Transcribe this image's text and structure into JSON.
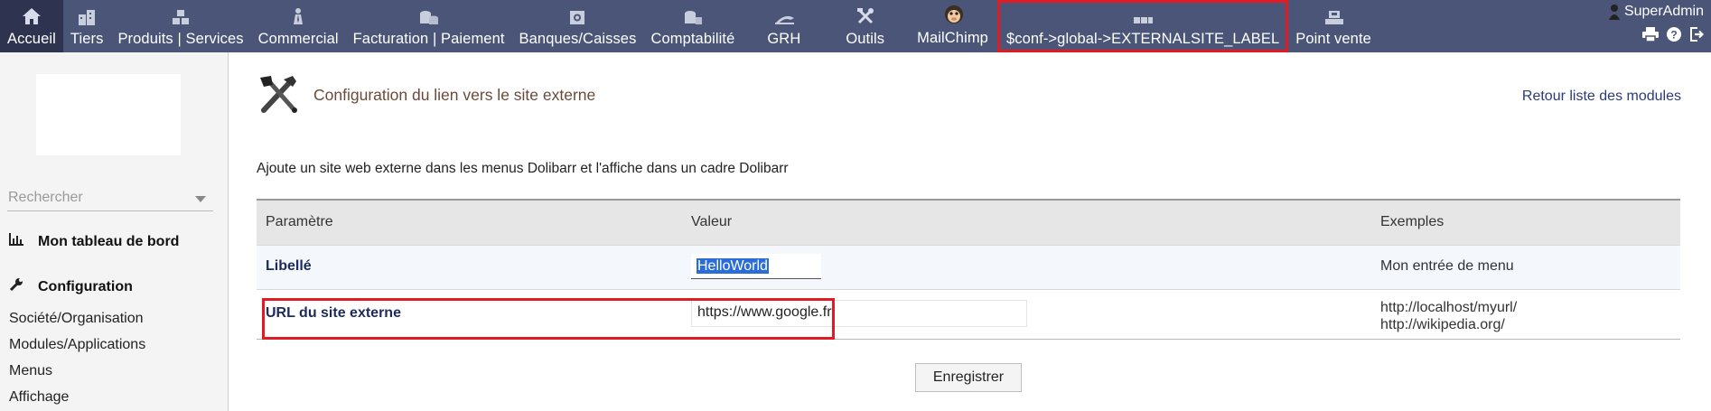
{
  "topmenu": {
    "items": [
      {
        "label": "Accueil",
        "icon": "home-icon",
        "active": true
      },
      {
        "label": "Tiers",
        "icon": "buildings-icon"
      },
      {
        "label": "Produits | Services",
        "icon": "products-icon"
      },
      {
        "label": "Commercial",
        "icon": "commercial-icon"
      },
      {
        "label": "Facturation | Paiement",
        "icon": "billing-icon"
      },
      {
        "label": "Banques/Caisses",
        "icon": "bank-icon"
      },
      {
        "label": "Comptabilité",
        "icon": "accounting-icon"
      },
      {
        "label": "GRH",
        "icon": "hrm-icon"
      },
      {
        "label": "Outils",
        "icon": "tools-icon"
      },
      {
        "label": "MailChimp",
        "icon": "mailchimp-icon"
      },
      {
        "label": "$conf->global->EXTERNALSITE_LABEL",
        "icon": "external-site-icon",
        "highlight": true
      },
      {
        "label": "Point vente",
        "icon": "pos-icon"
      }
    ],
    "user": "SuperAdmin"
  },
  "sidebar": {
    "search_placeholder": "Rechercher",
    "dashboard_label": "Mon tableau de bord",
    "config_label": "Configuration",
    "links": [
      "Société/Organisation",
      "Modules/Applications",
      "Menus",
      "Affichage"
    ]
  },
  "main": {
    "title": "Configuration du lien vers le site externe",
    "back_link": "Retour liste des modules",
    "description": "Ajoute un site web externe dans les menus Dolibarr et l'affiche dans un cadre Dolibarr",
    "table": {
      "headers": [
        "Paramètre",
        "Valeur",
        "Exemples"
      ],
      "rows": [
        {
          "param": "Libellé",
          "value": "HelloWorld",
          "example": "Mon entrée de menu"
        },
        {
          "param": "URL du site externe",
          "value": "https://www.google.fr",
          "example_lines": [
            "http://localhost/myurl/",
            "http://wikipedia.org/"
          ]
        }
      ]
    },
    "save_label": "Enregistrer"
  },
  "colors": {
    "topbar": "#4a5578",
    "active_tab": "#2e3450",
    "highlight": "#e01b24",
    "selection": "#2a6cd8"
  }
}
